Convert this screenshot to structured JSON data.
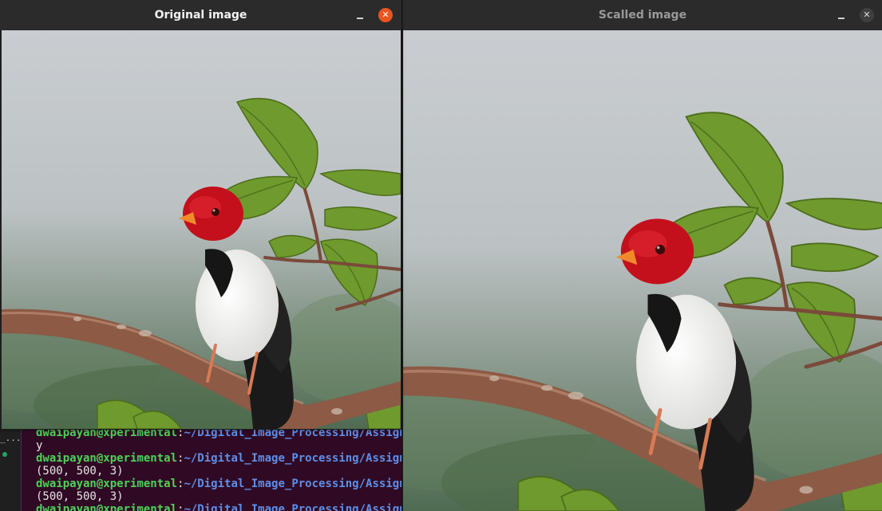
{
  "terminal": {
    "gutter_label": "_...",
    "prompt_user": "dwaipayan@xperimental",
    "prompt_path": "~/Digital_Image_Processing/Assignment",
    "lines": [
      "y",
      "(500, 500, 3)",
      "(500, 500, 3)"
    ]
  },
  "windows": {
    "left": {
      "title": "Original image",
      "close_symbol": "✕"
    },
    "right": {
      "title": "Scalled image",
      "close_symbol": "✕"
    }
  },
  "colors": {
    "close_active": "#e95420",
    "terminal_bg": "#300a24",
    "prompt_user": "#4fd15a",
    "prompt_path": "#5e8fe8"
  },
  "image": {
    "subject_icon": "bird-on-branch-photo"
  }
}
